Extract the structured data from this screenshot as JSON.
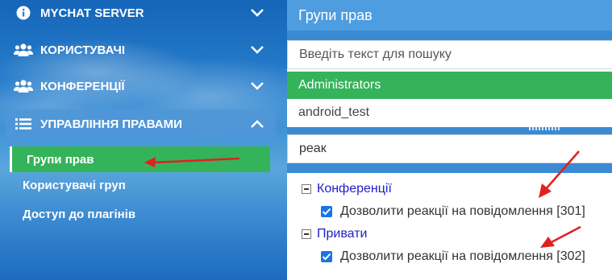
{
  "sidebar": {
    "items": [
      {
        "label": "MYCHAT SERVER",
        "icon": "info-circle-icon"
      },
      {
        "label": "КОРИСТУВАЧІ",
        "icon": "users-icon"
      },
      {
        "label": "КОНФЕРЕНЦІЇ",
        "icon": "users-icon"
      },
      {
        "label": "УПРАВЛІННЯ ПРАВАМИ",
        "icon": "list-icon"
      }
    ],
    "subitems": [
      {
        "label": "Групи прав"
      },
      {
        "label": "Користувачі груп"
      },
      {
        "label": "Доступ до плагінів"
      }
    ]
  },
  "panel": {
    "title": "Групи прав",
    "search_placeholder": "Введіть текст для пошуку",
    "groups": [
      {
        "name": "Administrators"
      },
      {
        "name": "android_test"
      }
    ],
    "filter_value": "реак",
    "tree": [
      {
        "category": "Конференції",
        "permission": "Дозволити реакції на повідомлення [301]"
      },
      {
        "category": "Привати",
        "permission": "Дозволити реакції на повідомлення [302]"
      }
    ]
  },
  "colors": {
    "accent_green": "#35b35a",
    "header_blue": "#4d9de0",
    "annotation_red": "#e02020",
    "checkbox_blue": "#1a73e8"
  }
}
